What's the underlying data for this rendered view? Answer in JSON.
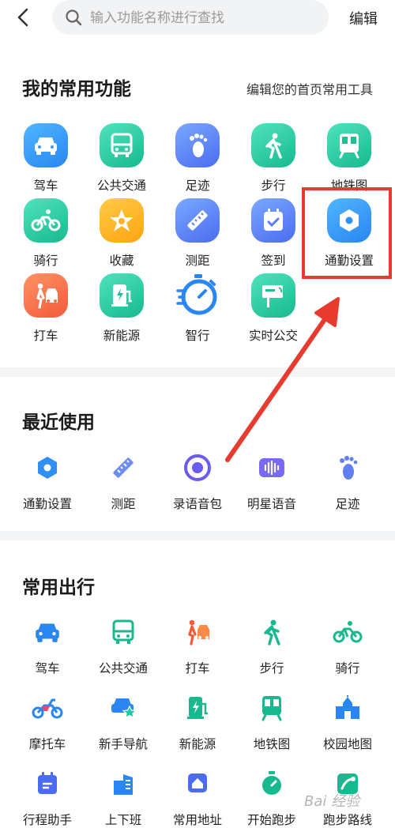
{
  "topbar": {
    "search_placeholder": "输入功能名称进行查找",
    "edit_label": "编辑"
  },
  "favorites": {
    "title": "我的常用功能",
    "edit_home_tools": "编辑您的首页常用工具",
    "items": [
      {
        "label": "驾车",
        "icon": "car-icon"
      },
      {
        "label": "公共交通",
        "icon": "bus-icon"
      },
      {
        "label": "足迹",
        "icon": "footprint-icon"
      },
      {
        "label": "步行",
        "icon": "walk-icon"
      },
      {
        "label": "地铁图",
        "icon": "subway-icon"
      },
      {
        "label": "骑行",
        "icon": "bike-icon"
      },
      {
        "label": "收藏",
        "icon": "star-icon"
      },
      {
        "label": "测距",
        "icon": "ruler-icon"
      },
      {
        "label": "签到",
        "icon": "checkin-icon"
      },
      {
        "label": "通勤设置",
        "icon": "hexagon-settings-icon"
      },
      {
        "label": "打车",
        "icon": "taxi-icon"
      },
      {
        "label": "新能源",
        "icon": "charging-icon"
      },
      {
        "label": "智行",
        "icon": "stopwatch-icon"
      },
      {
        "label": "实时公交",
        "icon": "bus-stop-icon"
      }
    ]
  },
  "recent": {
    "title": "最近使用",
    "items": [
      {
        "label": "通勤设置",
        "icon": "hexagon-settings-icon"
      },
      {
        "label": "测距",
        "icon": "ruler-icon"
      },
      {
        "label": "录语音包",
        "icon": "record-icon"
      },
      {
        "label": "明星语音",
        "icon": "voice-wave-icon"
      },
      {
        "label": "足迹",
        "icon": "footprint-icon"
      }
    ]
  },
  "travel": {
    "title": "常用出行",
    "items": [
      {
        "label": "驾车",
        "icon": "car-icon"
      },
      {
        "label": "公共交通",
        "icon": "bus-icon"
      },
      {
        "label": "打车",
        "icon": "taxi-icon"
      },
      {
        "label": "步行",
        "icon": "walk-icon"
      },
      {
        "label": "骑行",
        "icon": "bike-icon"
      },
      {
        "label": "摩托车",
        "icon": "motorcycle-icon"
      },
      {
        "label": "新手导航",
        "icon": "novice-car-icon"
      },
      {
        "label": "新能源",
        "icon": "charging-icon"
      },
      {
        "label": "地铁图",
        "icon": "subway-icon"
      },
      {
        "label": "校园地图",
        "icon": "campus-icon"
      },
      {
        "label": "行程助手",
        "icon": "calendar-icon"
      },
      {
        "label": "上下班",
        "icon": "building-icon"
      },
      {
        "label": "常用地址",
        "icon": "home-pin-icon"
      },
      {
        "label": "开始跑步",
        "icon": "timer-icon"
      },
      {
        "label": "跑步路线",
        "icon": "route-icon"
      }
    ]
  },
  "watermark": "Bai 经验",
  "colors": {
    "accent_blue": "#2a86f0",
    "accent_teal": "#18b98f",
    "annotation_red": "#e63b2e"
  }
}
